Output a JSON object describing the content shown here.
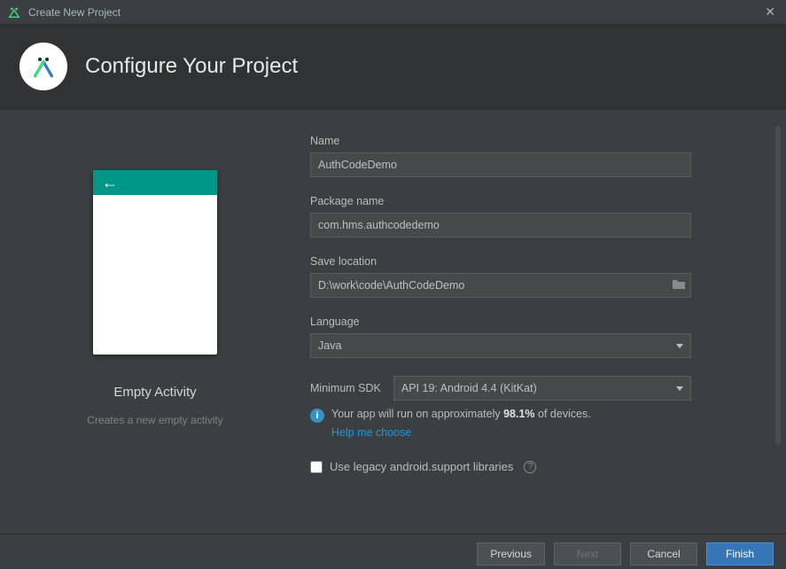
{
  "window": {
    "title": "Create New Project"
  },
  "header": {
    "title": "Configure Your Project"
  },
  "template": {
    "name": "Empty Activity",
    "description": "Creates a new empty activity"
  },
  "form": {
    "name_label": "Name",
    "name_value": "AuthCodeDemo",
    "package_label": "Package name",
    "package_value": "com.hms.authcodedemo",
    "location_label": "Save location",
    "location_value": "D:\\work\\code\\AuthCodeDemo",
    "language_label": "Language",
    "language_value": "Java",
    "minsdk_label": "Minimum SDK",
    "minsdk_value": "API 19: Android 4.4 (KitKat)",
    "compat_prefix": "Your app will run on approximately ",
    "compat_pct": "98.1%",
    "compat_suffix": " of devices.",
    "help_link": "Help me choose",
    "legacy_label": "Use legacy android.support libraries"
  },
  "footer": {
    "previous": "Previous",
    "next": "Next",
    "cancel": "Cancel",
    "finish": "Finish"
  }
}
